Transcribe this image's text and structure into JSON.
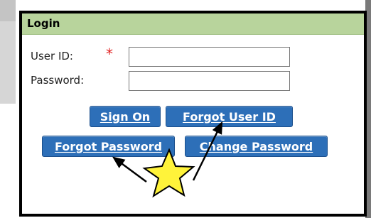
{
  "login": {
    "title": "Login",
    "user_id_label": "User ID:",
    "required_marker": "*",
    "password_label": "Password:",
    "user_id_value": "",
    "password_value": ""
  },
  "buttons": {
    "sign_on": "Sign On",
    "forgot_user_id": "Forgot User ID",
    "forgot_password": "Forgot Password",
    "change_password": "Change Password"
  },
  "annotation": {
    "star_color": "#fff33a",
    "arrow_color": "#000000"
  },
  "colors": {
    "header_bg": "#b8d49c",
    "button_bg": "#2d6fb8",
    "required": "#e02020"
  }
}
